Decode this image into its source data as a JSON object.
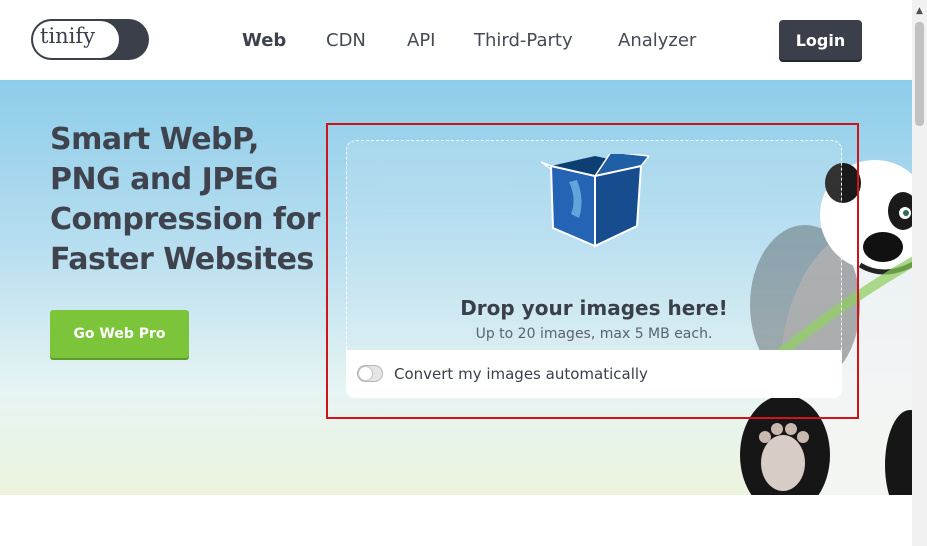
{
  "header": {
    "logo_text": "tinify",
    "nav": [
      {
        "label": "Web",
        "active": true
      },
      {
        "label": "CDN",
        "active": false
      },
      {
        "label": "API",
        "active": false
      },
      {
        "label": "Third-Party",
        "active": false
      },
      {
        "label": "Analyzer",
        "active": false
      }
    ],
    "login_label": "Login"
  },
  "hero": {
    "headline": "Smart WebP, PNG and JPEG Compression for Faster Websites",
    "cta_label": "Go Web Pro"
  },
  "dropzone": {
    "icon": "box-icon",
    "title": "Drop your images here!",
    "subtitle": "Up to 20 images, max 5 MB each.",
    "toggle_label": "Convert my images automatically",
    "toggle_on": false
  },
  "colors": {
    "accent_green": "#7cc43a",
    "dark_button": "#3b3f4a",
    "highlight_border": "#d0141c"
  }
}
